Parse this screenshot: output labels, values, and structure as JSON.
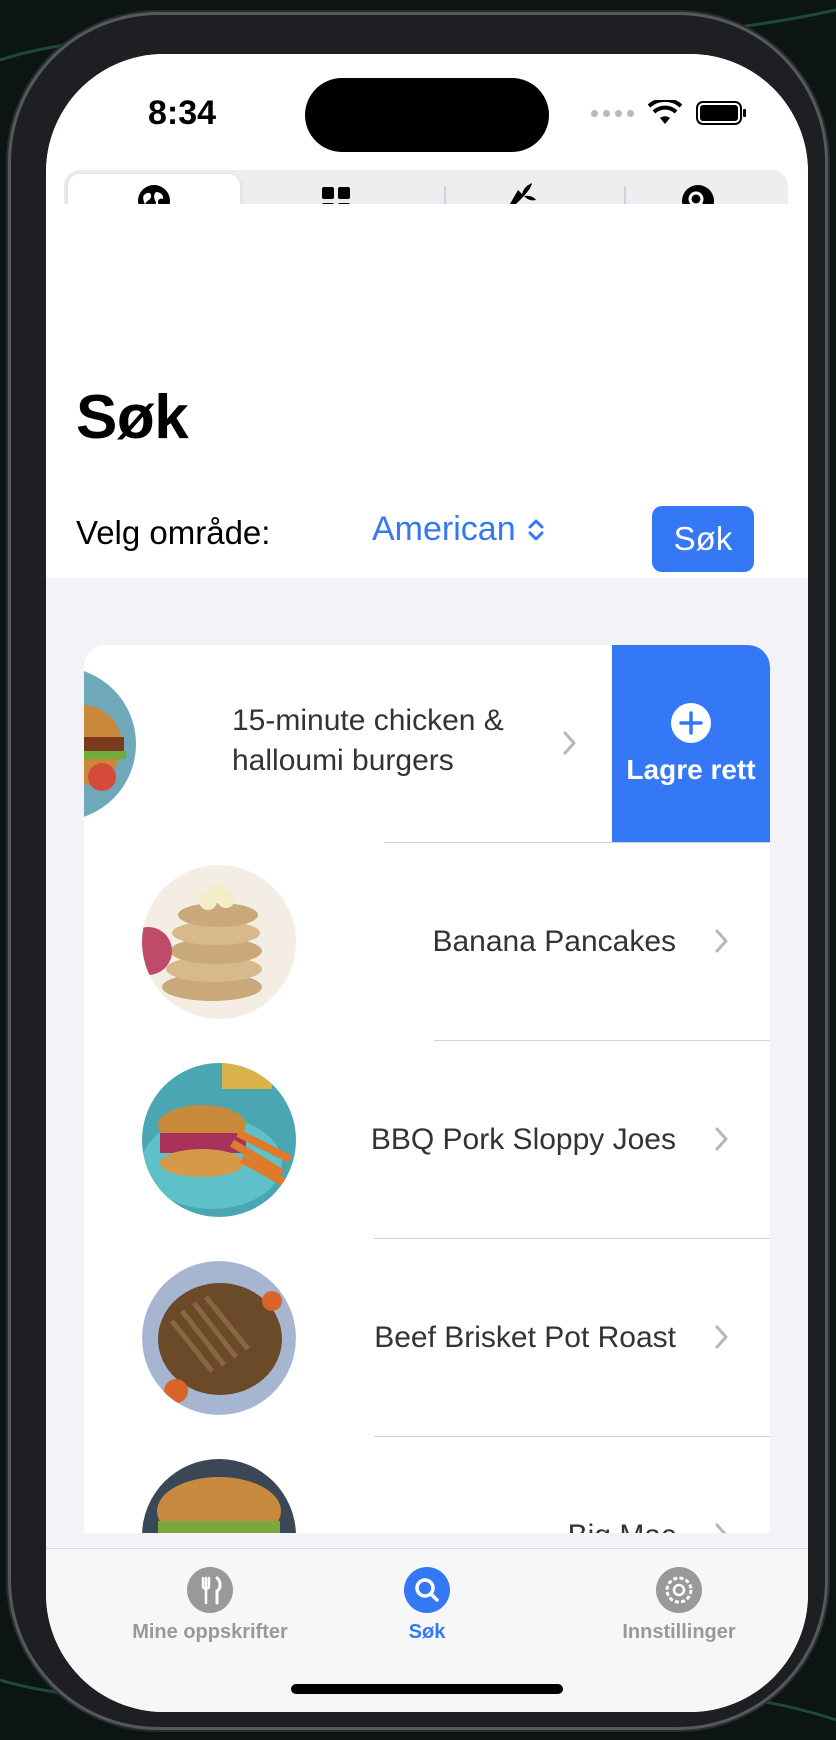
{
  "status_bar": {
    "time": "8:34"
  },
  "segmented_control": {
    "segments": [
      {
        "icon": "globe-icon",
        "active": true
      },
      {
        "icon": "grid-icon",
        "active": false
      },
      {
        "icon": "carrot-icon",
        "active": false
      },
      {
        "icon": "search-icon",
        "active": false
      }
    ]
  },
  "header": {
    "title": "Søk",
    "area_label": "Velg område:",
    "area_value": "American",
    "search_button": "Søk"
  },
  "recipes": [
    {
      "title": "15-minute chicken & halloumi burgers",
      "swiped": true,
      "action": "Lagre rett"
    },
    {
      "title": "Banana Pancakes"
    },
    {
      "title": "BBQ Pork Sloppy Joes"
    },
    {
      "title": "Beef Brisket Pot Roast"
    },
    {
      "title": "Big Mac"
    }
  ],
  "tab_bar": {
    "tabs": [
      {
        "label": "Mine oppskrifter",
        "icon": "fork-knife-icon",
        "active": false
      },
      {
        "label": "Søk",
        "icon": "search-icon",
        "active": true
      },
      {
        "label": "Innstillinger",
        "icon": "gear-icon",
        "active": false
      }
    ]
  },
  "colors": {
    "accent": "#3478f6",
    "inactive_tab": "#999999"
  }
}
